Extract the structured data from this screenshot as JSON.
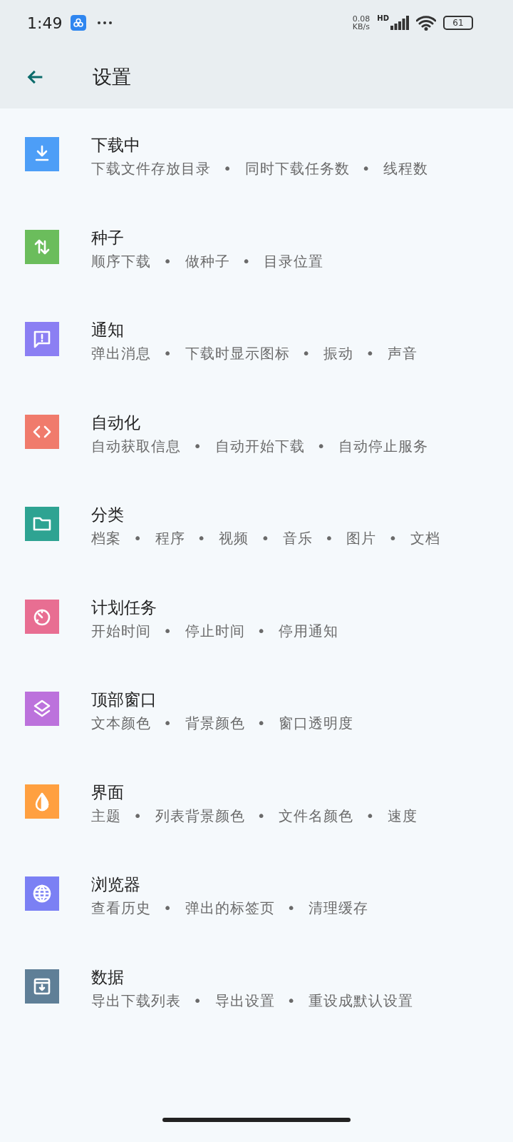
{
  "status_bar": {
    "time": "1:49",
    "speed_value": "0.08",
    "speed_unit": "KB/s",
    "network": "HD",
    "battery": "61"
  },
  "toolbar": {
    "title": "设置"
  },
  "items": [
    {
      "kind": "download",
      "color": "#4d9ef7",
      "title": "下载中",
      "subtitle": "下载文件存放目录 • 同时下载任务数 • 线程数"
    },
    {
      "kind": "swap",
      "color": "#6bbd5c",
      "title": "种子",
      "subtitle": "顺序下载 • 做种子 • 目录位置"
    },
    {
      "kind": "message",
      "color": "#8b7ff3",
      "title": "通知",
      "subtitle": "弹出消息 • 下载时显示图标 • 振动 • 声音"
    },
    {
      "kind": "code",
      "color": "#f07b6c",
      "title": "自动化",
      "subtitle": "自动获取信息 • 自动开始下载 • 自动停止服务"
    },
    {
      "kind": "folder",
      "color": "#2ea392",
      "title": "分类",
      "subtitle": "档案 • 程序 • 视频 • 音乐 • 图片 • 文档"
    },
    {
      "kind": "timer",
      "color": "#e86e92",
      "title": "计划任务",
      "subtitle": "开始时间 • 停止时间 • 停用通知"
    },
    {
      "kind": "layers",
      "color": "#bc72dc",
      "title": "顶部窗口",
      "subtitle": "文本颜色 • 背景颜色 • 窗口透明度"
    },
    {
      "kind": "drop",
      "color": "#ffa040",
      "title": "界面",
      "subtitle": "主题 • 列表背景颜色 • 文件名颜色 • 速度"
    },
    {
      "kind": "globe",
      "color": "#7b80f4",
      "title": "浏览器",
      "subtitle": "查看历史 • 弹出的标签页 • 清理缓存"
    },
    {
      "kind": "archive",
      "color": "#5f7f97",
      "title": "数据",
      "subtitle": "导出下载列表 • 导出设置 • 重设成默认设置"
    }
  ]
}
